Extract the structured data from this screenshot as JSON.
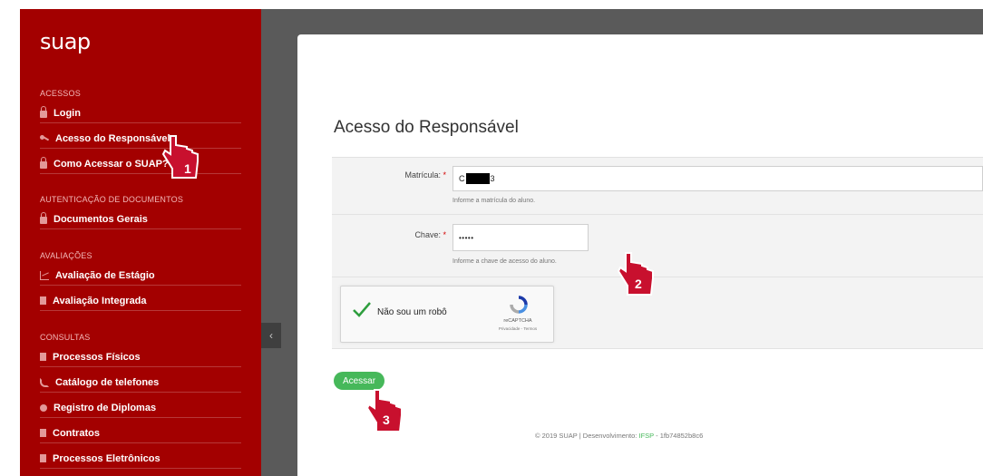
{
  "logo": "suap",
  "sidebar": {
    "sections": [
      {
        "title": "ACESSOS",
        "items": [
          {
            "label": "Login",
            "icon": "lock-icon"
          },
          {
            "label": "Acesso do Responsável",
            "icon": "key-icon"
          },
          {
            "label": "Como Acessar o SUAP?",
            "icon": "lock-icon"
          }
        ]
      },
      {
        "title": "AUTENTICAÇÃO DE DOCUMENTOS",
        "items": [
          {
            "label": "Documentos Gerais",
            "icon": "lock-icon"
          }
        ]
      },
      {
        "title": "AVALIAÇÕES",
        "items": [
          {
            "label": "Avaliação de Estágio",
            "icon": "chart-icon"
          },
          {
            "label": "Avaliação Integrada",
            "icon": "document-icon"
          }
        ]
      },
      {
        "title": "CONSULTAS",
        "items": [
          {
            "label": "Processos Físicos",
            "icon": "document-icon"
          },
          {
            "label": "Catálogo de telefones",
            "icon": "phone-icon"
          },
          {
            "label": "Registro de Diplomas",
            "icon": "circle-icon"
          },
          {
            "label": "Contratos",
            "icon": "document-icon"
          },
          {
            "label": "Processos Eletrônicos",
            "icon": "document-icon"
          }
        ]
      }
    ],
    "collapse_glyph": "‹"
  },
  "page": {
    "title": "Acesso do Responsável"
  },
  "form": {
    "matricula": {
      "label": "Matrícula:",
      "required_mark": "*",
      "value_start": "C",
      "value_end": "3",
      "help": "Informe a matrícula do aluno."
    },
    "chave": {
      "label": "Chave:",
      "required_mark": "*",
      "value": "•••••",
      "help": "Informe a chave de acesso do aluno."
    },
    "captcha": {
      "label": "Não sou um robô",
      "brand": "reCAPTCHA",
      "terms": "Privacidade - Termos"
    },
    "submit_label": "Acessar"
  },
  "footer": {
    "prefix": "© 2019 SUAP | Desenvolvimento: ",
    "org": "IFSP",
    "suffix": " - 1fb74852b8c6"
  },
  "annotations": [
    "1",
    "2",
    "3"
  ],
  "colors": {
    "sidebar_bg": "#a30000",
    "accent_green": "#46b85a",
    "annotation_red": "#c8102e"
  }
}
